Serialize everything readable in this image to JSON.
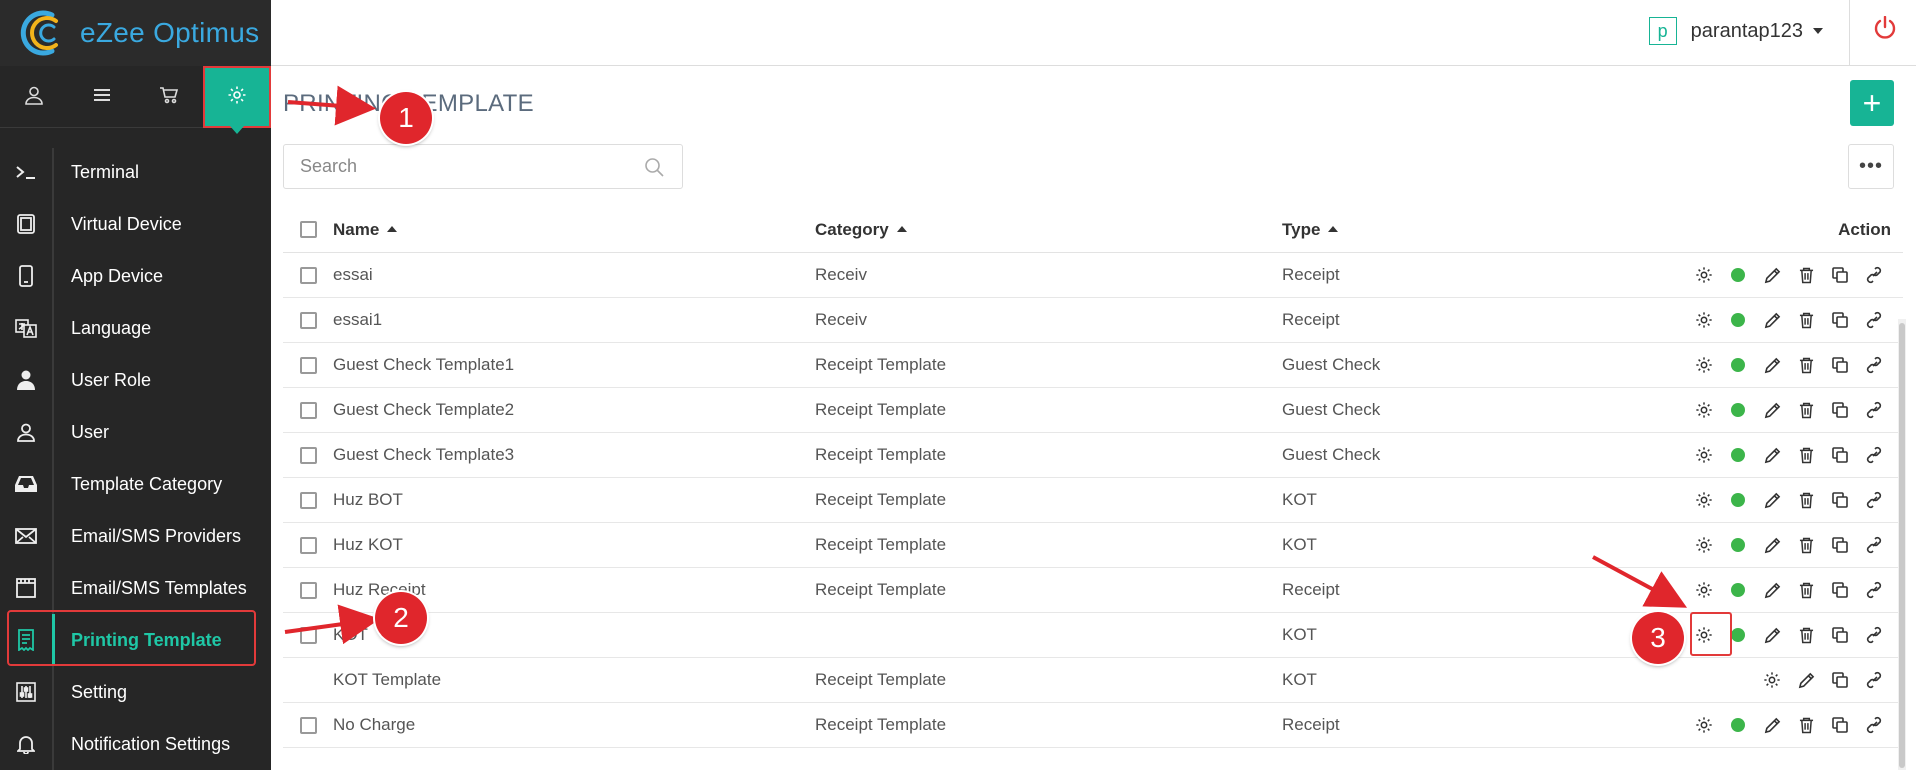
{
  "app": {
    "name": "eZee Optimus"
  },
  "header": {
    "user_initial": "p",
    "user_name": "parantap123"
  },
  "nav": {
    "items": [
      {
        "label": "Terminal",
        "icon": "terminal-icon"
      },
      {
        "label": "Virtual Device",
        "icon": "tablet-icon"
      },
      {
        "label": "App Device",
        "icon": "mobile-icon"
      },
      {
        "label": "Language",
        "icon": "language-icon"
      },
      {
        "label": "User Role",
        "icon": "user-role-icon"
      },
      {
        "label": "User",
        "icon": "user-icon"
      },
      {
        "label": "Template Category",
        "icon": "inbox-icon"
      },
      {
        "label": "Email/SMS Providers",
        "icon": "envelope-icon"
      },
      {
        "label": "Email/SMS Templates",
        "icon": "template-icon"
      },
      {
        "label": "Printing Template",
        "icon": "receipt-icon"
      },
      {
        "label": "Setting",
        "icon": "sliders-icon"
      },
      {
        "label": "Notification Settings",
        "icon": "bell-icon"
      }
    ],
    "active": "Printing Template"
  },
  "page": {
    "title": "PRINTING TEMPLATE",
    "search_placeholder": "Search",
    "add_label": "+",
    "more_label": "•••"
  },
  "table": {
    "columns": {
      "name": "Name",
      "category": "Category",
      "type": "Type",
      "action": "Action"
    },
    "rows": [
      {
        "name": "essai",
        "category": "Receiv",
        "type": "Receipt",
        "checkbox": true,
        "status": true
      },
      {
        "name": "essai1",
        "category": "Receiv",
        "type": "Receipt",
        "checkbox": true,
        "status": true
      },
      {
        "name": "Guest Check Template1",
        "category": "Receipt Template",
        "type": "Guest Check",
        "checkbox": true,
        "status": true
      },
      {
        "name": "Guest Check Template2",
        "category": "Receipt Template",
        "type": "Guest Check",
        "checkbox": true,
        "status": true
      },
      {
        "name": "Guest Check Template3",
        "category": "Receipt Template",
        "type": "Guest Check",
        "checkbox": true,
        "status": true
      },
      {
        "name": "Huz BOT",
        "category": "Receipt Template",
        "type": "KOT",
        "checkbox": true,
        "status": true
      },
      {
        "name": "Huz KOT",
        "category": "Receipt Template",
        "type": "KOT",
        "checkbox": true,
        "status": true
      },
      {
        "name": "Huz Receipt",
        "category": "Receipt Template",
        "type": "Receipt",
        "checkbox": true,
        "status": true
      },
      {
        "name": "KOT",
        "category": "",
        "type": "KOT",
        "checkbox": true,
        "status": true
      },
      {
        "name": "KOT Template",
        "category": "Receipt Template",
        "type": "KOT",
        "checkbox": false,
        "status": false
      },
      {
        "name": "No Charge",
        "category": "Receipt Template",
        "type": "Receipt",
        "checkbox": true,
        "status": true
      }
    ]
  },
  "annotations": {
    "step1": "1",
    "step2": "2",
    "step3": "3"
  },
  "colors": {
    "accent": "#17b495",
    "sidebar": "#262626",
    "annotation": "#e0262c",
    "status": "#3cb54a"
  }
}
